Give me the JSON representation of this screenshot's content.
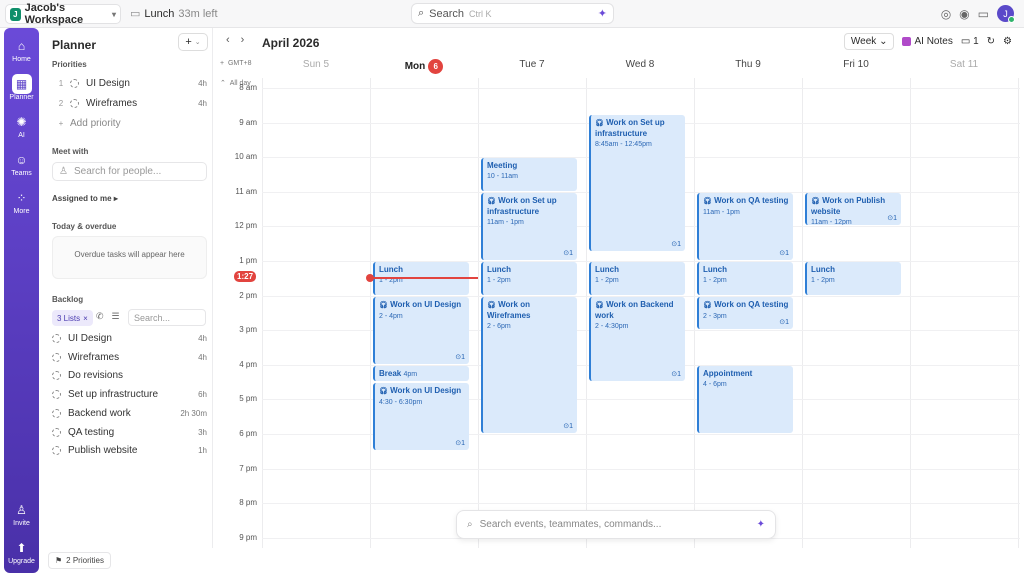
{
  "topbar": {
    "workspace_initial": "J",
    "workspace_name": "Jacob's Workspace",
    "current_event": "Lunch",
    "current_event_remaining": "33m left",
    "search_placeholder": "Search",
    "search_shortcut": "Ctrl K",
    "avatar_initial": "J"
  },
  "rail": {
    "items": [
      {
        "label": "Home",
        "icon": "home-icon"
      },
      {
        "label": "Planner",
        "icon": "planner-icon"
      },
      {
        "label": "AI",
        "icon": "ai-icon"
      },
      {
        "label": "Teams",
        "icon": "teams-icon"
      },
      {
        "label": "More",
        "icon": "more-icon"
      }
    ],
    "invite": "Invite",
    "upgrade": "Upgrade"
  },
  "panel": {
    "title": "Planner",
    "priorities_heading": "Priorities",
    "priorities": [
      {
        "num": "1",
        "name": "UI Design",
        "hours": "4h"
      },
      {
        "num": "2",
        "name": "Wireframes",
        "hours": "4h"
      }
    ],
    "add_priority": "Add priority",
    "meet_with": "Meet with",
    "people_placeholder": "Search for people...",
    "assigned": "Assigned to me",
    "today_overdue": "Today & overdue",
    "overdue_empty": "Overdue tasks will appear here",
    "backlog": "Backlog",
    "lists_badge": "3 Lists",
    "backlog_search": "Search...",
    "backlog_items": [
      {
        "name": "UI Design",
        "hours": "4h"
      },
      {
        "name": "Wireframes",
        "hours": "4h"
      },
      {
        "name": "Do revisions",
        "hours": ""
      },
      {
        "name": "Set up infrastructure",
        "hours": "6h"
      },
      {
        "name": "Backend work",
        "hours": "2h 30m"
      },
      {
        "name": "QA testing",
        "hours": "3h"
      },
      {
        "name": "Publish website",
        "hours": "1h"
      }
    ],
    "footer_priorities": "2 Priorities"
  },
  "calendar": {
    "month": "April 2026",
    "view": "Week",
    "ai_notes": "AI Notes",
    "cal_count": "1",
    "timezone": "GMT+8",
    "allday": "All day",
    "days": [
      {
        "label": "Sun 5",
        "weekend": true
      },
      {
        "label": "Mon",
        "today": true,
        "badge": "6"
      },
      {
        "label": "Tue 7"
      },
      {
        "label": "Wed 8"
      },
      {
        "label": "Thu 9"
      },
      {
        "label": "Fri 10"
      },
      {
        "label": "Sat 11",
        "weekend": true
      }
    ],
    "hours": [
      "8 am",
      "9 am",
      "10 am",
      "11 am",
      "12 pm",
      "1 pm",
      "2 pm",
      "3 pm",
      "4 pm",
      "5 pm",
      "6 pm",
      "7 pm",
      "8 pm",
      "9 pm"
    ],
    "now_label": "1:27",
    "events": [
      {
        "day": 1,
        "title": "Lunch",
        "time": "1 - 2pm"
      },
      {
        "day": 1,
        "title": "Work on UI Design",
        "time": "2 - 4pm",
        "headphones": true,
        "check": "1"
      },
      {
        "day": 1,
        "title": "Break",
        "time": "4pm",
        "inline": true
      },
      {
        "day": 1,
        "title": "Work on UI Design",
        "time": "4:30 - 6:30pm",
        "headphones": true,
        "check": "1"
      },
      {
        "day": 2,
        "title": "Meeting",
        "time": "10 - 11am"
      },
      {
        "day": 2,
        "title": "Work on Set up infrastructure",
        "time": "11am - 1pm",
        "headphones": true,
        "check": "1"
      },
      {
        "day": 2,
        "title": "Lunch",
        "time": "1 - 2pm"
      },
      {
        "day": 2,
        "title": "Work on Wireframes",
        "time": "2 - 6pm",
        "headphones": true,
        "check": "1"
      },
      {
        "day": 3,
        "title": "Work on Set up infrastructure",
        "time": "8:45am - 12:45pm",
        "headphones": true,
        "check": "1"
      },
      {
        "day": 3,
        "title": "Lunch",
        "time": "1 - 2pm"
      },
      {
        "day": 3,
        "title": "Work on Backend work",
        "time": "2 - 4:30pm",
        "headphones": true,
        "check": "1"
      },
      {
        "day": 4,
        "title": "Work on QA testing",
        "time": "11am - 1pm",
        "headphones": true,
        "check": "1"
      },
      {
        "day": 4,
        "title": "Lunch",
        "time": "1 - 2pm"
      },
      {
        "day": 4,
        "title": "Work on QA testing",
        "time": "2 - 3pm",
        "headphones": true,
        "check": "1"
      },
      {
        "day": 4,
        "title": "Appointment",
        "time": "4 - 6pm"
      },
      {
        "day": 5,
        "title": "Work on Publish website",
        "time": "11am - 12pm",
        "headphones": true,
        "check": "1"
      },
      {
        "day": 5,
        "title": "Lunch",
        "time": "1 - 2pm"
      }
    ],
    "command_placeholder": "Search events, teammates, commands..."
  }
}
